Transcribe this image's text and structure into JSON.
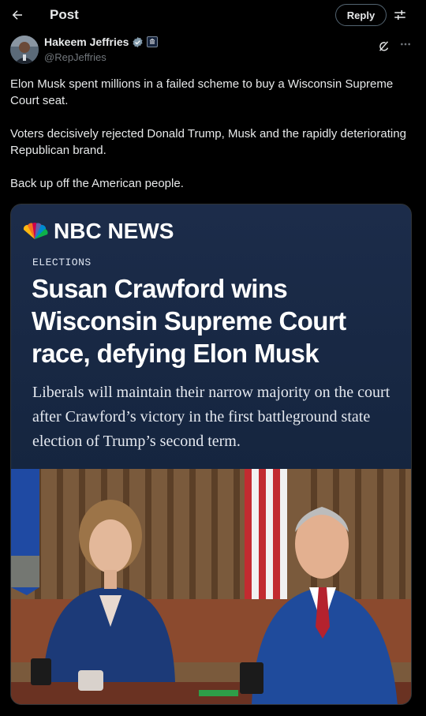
{
  "header": {
    "title": "Post",
    "reply_label": "Reply",
    "back_icon": "arrow-left-icon",
    "settings_icon": "sliders-icon"
  },
  "author": {
    "name": "Hakeem Jeffries",
    "handle": "@RepJeffries",
    "verified_badge": "verified-badge-icon",
    "affiliation_badge": "government-badge-icon"
  },
  "tweet": {
    "paragraphs": [
      "Elon Musk spent millions in a failed scheme to buy a Wisconsin Supreme Court seat.",
      "Voters decisively rejected Donald Trump, Musk and the rapidly deteriorating Republican brand.",
      "Back up off the American people."
    ]
  },
  "media": {
    "brand": "NBC NEWS",
    "kicker": "ELECTIONS",
    "headline": "Susan Crawford wins Wisconsin Supreme Court race, defying Elon Musk",
    "dek": "Liberals will maintain their narrow majority on the court after Crawford’s victory in the first battleground state election of Trump’s second term."
  },
  "colors": {
    "background": "#000000",
    "text_primary": "#e7e9ea",
    "text_secondary": "#71767b",
    "verified": "#829aab",
    "nbc_navy": "#1a2a47"
  }
}
